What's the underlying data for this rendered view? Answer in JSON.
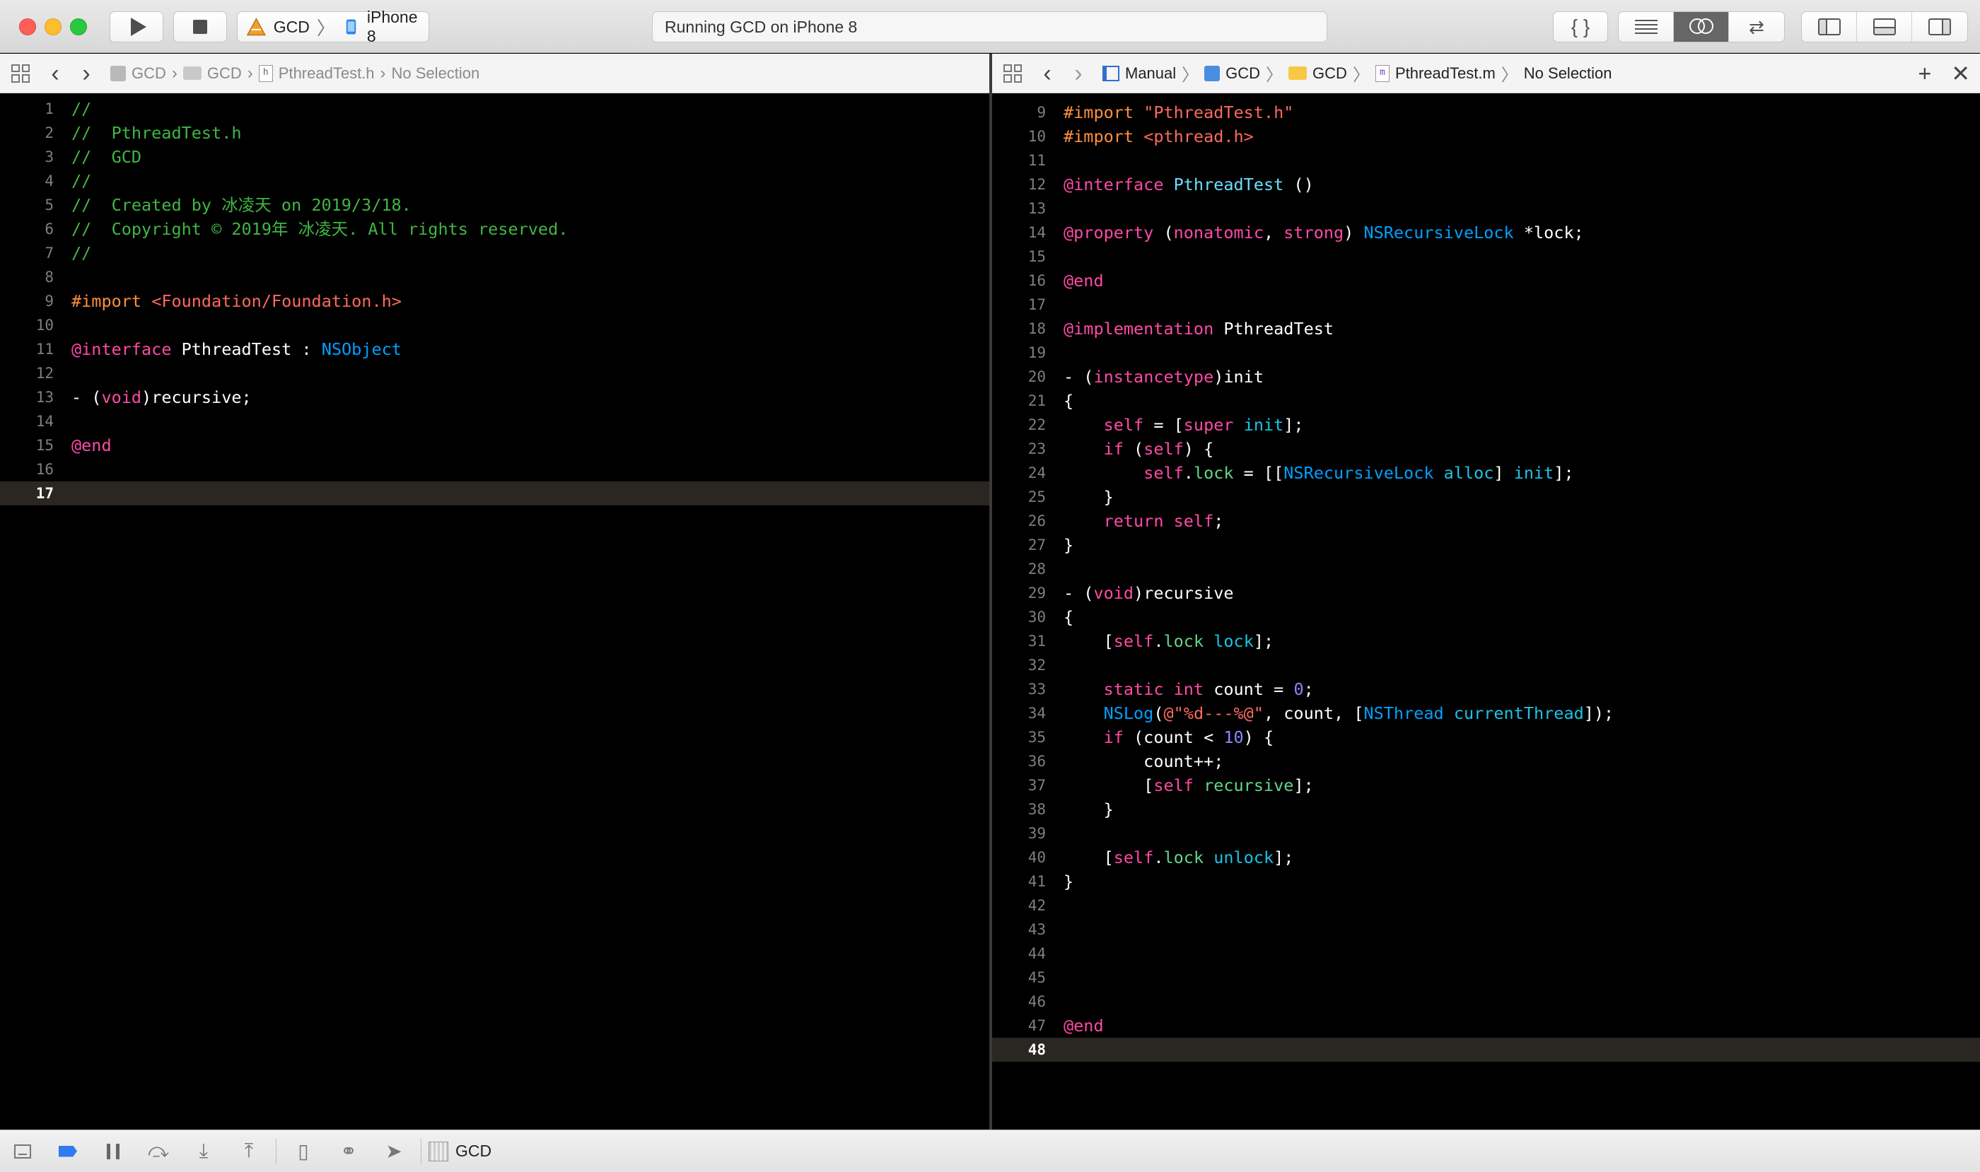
{
  "toolbar": {
    "scheme_name": "GCD",
    "device_name": "iPhone 8",
    "status": "Running GCD on iPhone 8",
    "braces_label": "{ }"
  },
  "left_jump_bar": {
    "crumbs": [
      "GCD",
      "GCD",
      "PthreadTest.h",
      "No Selection"
    ]
  },
  "right_jump_bar": {
    "crumbs": [
      "Manual",
      "GCD",
      "GCD",
      "PthreadTest.m",
      "No Selection"
    ]
  },
  "left_editor": {
    "current_line": 17,
    "lines": [
      {
        "n": "1",
        "t": [
          {
            "c": "c",
            "v": "//"
          }
        ]
      },
      {
        "n": "2",
        "t": [
          {
            "c": "c",
            "v": "//  PthreadTest.h"
          }
        ]
      },
      {
        "n": "3",
        "t": [
          {
            "c": "c",
            "v": "//  GCD"
          }
        ]
      },
      {
        "n": "4",
        "t": [
          {
            "c": "c",
            "v": "//"
          }
        ]
      },
      {
        "n": "5",
        "t": [
          {
            "c": "c",
            "v": "//  Created by 冰凌天 on 2019/3/18."
          }
        ]
      },
      {
        "n": "6",
        "t": [
          {
            "c": "c",
            "v": "//  Copyright © 2019年 冰凌天. All rights reserved."
          }
        ]
      },
      {
        "n": "7",
        "t": [
          {
            "c": "c",
            "v": "//"
          }
        ]
      },
      {
        "n": "8",
        "t": []
      },
      {
        "n": "9",
        "t": [
          {
            "c": "pp",
            "v": "#import "
          },
          {
            "c": "s",
            "v": "<Foundation/Foundation.h>"
          }
        ]
      },
      {
        "n": "10",
        "t": []
      },
      {
        "n": "11",
        "t": [
          {
            "c": "k",
            "v": "@interface"
          },
          {
            "c": "p",
            "v": " PthreadTest : "
          },
          {
            "c": "cl",
            "v": "NSObject"
          }
        ]
      },
      {
        "n": "12",
        "t": []
      },
      {
        "n": "13",
        "t": [
          {
            "c": "p",
            "v": "- ("
          },
          {
            "c": "k",
            "v": "void"
          },
          {
            "c": "p",
            "v": ")recursive;"
          }
        ]
      },
      {
        "n": "14",
        "t": []
      },
      {
        "n": "15",
        "t": [
          {
            "c": "k",
            "v": "@end"
          }
        ]
      },
      {
        "n": "16",
        "t": []
      },
      {
        "n": "17",
        "t": []
      }
    ]
  },
  "right_editor": {
    "current_line": 48,
    "lines": [
      {
        "n": "9",
        "t": [
          {
            "c": "pp",
            "v": "#import "
          },
          {
            "c": "s",
            "v": "\"PthreadTest.h\""
          }
        ]
      },
      {
        "n": "10",
        "t": [
          {
            "c": "pp",
            "v": "#import "
          },
          {
            "c": "s",
            "v": "<pthread.h>"
          }
        ]
      },
      {
        "n": "11",
        "t": []
      },
      {
        "n": "12",
        "t": [
          {
            "c": "k",
            "v": "@interface"
          },
          {
            "c": "p",
            "v": " "
          },
          {
            "c": "t",
            "v": "PthreadTest"
          },
          {
            "c": "p",
            "v": " ()"
          }
        ]
      },
      {
        "n": "13",
        "t": []
      },
      {
        "n": "14",
        "t": [
          {
            "c": "k",
            "v": "@property"
          },
          {
            "c": "p",
            "v": " ("
          },
          {
            "c": "k",
            "v": "nonatomic"
          },
          {
            "c": "p",
            "v": ", "
          },
          {
            "c": "k",
            "v": "strong"
          },
          {
            "c": "p",
            "v": ") "
          },
          {
            "c": "cl",
            "v": "NSRecursiveLock"
          },
          {
            "c": "p",
            "v": " *lock;"
          }
        ]
      },
      {
        "n": "15",
        "t": []
      },
      {
        "n": "16",
        "t": [
          {
            "c": "k",
            "v": "@end"
          }
        ]
      },
      {
        "n": "17",
        "t": []
      },
      {
        "n": "18",
        "t": [
          {
            "c": "k",
            "v": "@implementation"
          },
          {
            "c": "p",
            "v": " PthreadTest"
          }
        ]
      },
      {
        "n": "19",
        "t": []
      },
      {
        "n": "20",
        "t": [
          {
            "c": "p",
            "v": "- ("
          },
          {
            "c": "k",
            "v": "instancetype"
          },
          {
            "c": "p",
            "v": ")init"
          }
        ]
      },
      {
        "n": "21",
        "t": [
          {
            "c": "p",
            "v": "{"
          }
        ]
      },
      {
        "n": "22",
        "t": [
          {
            "c": "p",
            "v": "    "
          },
          {
            "c": "k",
            "v": "self"
          },
          {
            "c": "p",
            "v": " = ["
          },
          {
            "c": "k",
            "v": "super"
          },
          {
            "c": "p",
            "v": " "
          },
          {
            "c": "m",
            "v": "init"
          },
          {
            "c": "p",
            "v": "];"
          }
        ]
      },
      {
        "n": "23",
        "t": [
          {
            "c": "p",
            "v": "    "
          },
          {
            "c": "k",
            "v": "if"
          },
          {
            "c": "p",
            "v": " ("
          },
          {
            "c": "k",
            "v": "self"
          },
          {
            "c": "p",
            "v": ") {"
          }
        ]
      },
      {
        "n": "24",
        "t": [
          {
            "c": "p",
            "v": "        "
          },
          {
            "c": "k",
            "v": "self"
          },
          {
            "c": "p",
            "v": "."
          },
          {
            "c": "pr",
            "v": "lock"
          },
          {
            "c": "p",
            "v": " = [["
          },
          {
            "c": "cl",
            "v": "NSRecursiveLock"
          },
          {
            "c": "p",
            "v": " "
          },
          {
            "c": "m",
            "v": "alloc"
          },
          {
            "c": "p",
            "v": "] "
          },
          {
            "c": "m",
            "v": "init"
          },
          {
            "c": "p",
            "v": "];"
          }
        ]
      },
      {
        "n": "25",
        "t": [
          {
            "c": "p",
            "v": "    }"
          }
        ]
      },
      {
        "n": "26",
        "t": [
          {
            "c": "p",
            "v": "    "
          },
          {
            "c": "k",
            "v": "return"
          },
          {
            "c": "p",
            "v": " "
          },
          {
            "c": "k",
            "v": "self"
          },
          {
            "c": "p",
            "v": ";"
          }
        ]
      },
      {
        "n": "27",
        "t": [
          {
            "c": "p",
            "v": "}"
          }
        ]
      },
      {
        "n": "28",
        "t": []
      },
      {
        "n": "29",
        "t": [
          {
            "c": "p",
            "v": "- ("
          },
          {
            "c": "k",
            "v": "void"
          },
          {
            "c": "p",
            "v": ")recursive"
          }
        ]
      },
      {
        "n": "30",
        "t": [
          {
            "c": "p",
            "v": "{"
          }
        ]
      },
      {
        "n": "31",
        "t": [
          {
            "c": "p",
            "v": "    ["
          },
          {
            "c": "k",
            "v": "self"
          },
          {
            "c": "p",
            "v": "."
          },
          {
            "c": "pr",
            "v": "lock"
          },
          {
            "c": "p",
            "v": " "
          },
          {
            "c": "m",
            "v": "lock"
          },
          {
            "c": "p",
            "v": "];"
          }
        ]
      },
      {
        "n": "32",
        "t": []
      },
      {
        "n": "33",
        "t": [
          {
            "c": "p",
            "v": "    "
          },
          {
            "c": "k",
            "v": "static"
          },
          {
            "c": "p",
            "v": " "
          },
          {
            "c": "k",
            "v": "int"
          },
          {
            "c": "p",
            "v": " count = "
          },
          {
            "c": "n",
            "v": "0"
          },
          {
            "c": "p",
            "v": ";"
          }
        ]
      },
      {
        "n": "34",
        "t": [
          {
            "c": "p",
            "v": "    "
          },
          {
            "c": "cl",
            "v": "NSLog"
          },
          {
            "c": "p",
            "v": "("
          },
          {
            "c": "s",
            "v": "@\"%d---%@\""
          },
          {
            "c": "p",
            "v": ", count, ["
          },
          {
            "c": "cl",
            "v": "NSThread"
          },
          {
            "c": "p",
            "v": " "
          },
          {
            "c": "m",
            "v": "currentThread"
          },
          {
            "c": "p",
            "v": "]);"
          }
        ]
      },
      {
        "n": "35",
        "t": [
          {
            "c": "p",
            "v": "    "
          },
          {
            "c": "k",
            "v": "if"
          },
          {
            "c": "p",
            "v": " (count < "
          },
          {
            "c": "n",
            "v": "10"
          },
          {
            "c": "p",
            "v": ") {"
          }
        ]
      },
      {
        "n": "36",
        "t": [
          {
            "c": "p",
            "v": "        count++;"
          }
        ]
      },
      {
        "n": "37",
        "t": [
          {
            "c": "p",
            "v": "        ["
          },
          {
            "c": "k",
            "v": "self"
          },
          {
            "c": "p",
            "v": " "
          },
          {
            "c": "pr",
            "v": "recursive"
          },
          {
            "c": "p",
            "v": "];"
          }
        ]
      },
      {
        "n": "38",
        "t": [
          {
            "c": "p",
            "v": "    }"
          }
        ]
      },
      {
        "n": "39",
        "t": []
      },
      {
        "n": "40",
        "t": [
          {
            "c": "p",
            "v": "    ["
          },
          {
            "c": "k",
            "v": "self"
          },
          {
            "c": "p",
            "v": "."
          },
          {
            "c": "pr",
            "v": "lock"
          },
          {
            "c": "p",
            "v": " "
          },
          {
            "c": "m",
            "v": "unlock"
          },
          {
            "c": "p",
            "v": "];"
          }
        ]
      },
      {
        "n": "41",
        "t": [
          {
            "c": "p",
            "v": "}"
          }
        ]
      },
      {
        "n": "42",
        "t": []
      },
      {
        "n": "43",
        "t": []
      },
      {
        "n": "44",
        "t": []
      },
      {
        "n": "45",
        "t": []
      },
      {
        "n": "46",
        "t": []
      },
      {
        "n": "47",
        "t": [
          {
            "c": "k",
            "v": "@end"
          }
        ]
      },
      {
        "n": "48",
        "t": []
      }
    ]
  },
  "debug_bar": {
    "process_label": "GCD"
  }
}
